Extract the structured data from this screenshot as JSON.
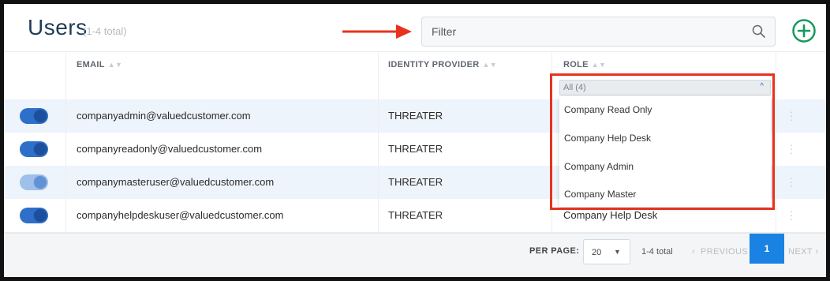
{
  "header": {
    "title": "Users",
    "count": "(1-4 total)",
    "filter_placeholder": "Filter"
  },
  "table": {
    "columns": {
      "email": "EMAIL",
      "identity_provider": "IDENTITY PROVIDER",
      "role": "ROLE"
    },
    "rows": [
      {
        "enabled": true,
        "email": "companyadmin@valuedcustomer.com",
        "identity_provider": "THREATER",
        "role": ""
      },
      {
        "enabled": true,
        "email": "companyreadonly@valuedcustomer.com",
        "identity_provider": "THREATER",
        "role": ""
      },
      {
        "enabled": true,
        "email": "companymasteruser@valuedcustomer.com",
        "identity_provider": "THREATER",
        "role": ""
      },
      {
        "enabled": true,
        "email": "companyhelpdeskuser@valuedcustomer.com",
        "identity_provider": "THREATER",
        "role": "Company Help Desk"
      }
    ]
  },
  "role_filter": {
    "selected": "All (4)",
    "options": [
      "Company Read Only",
      "Company Help Desk",
      "Company Admin",
      "Company Master"
    ]
  },
  "pagination": {
    "per_page_label": "PER PAGE:",
    "per_page_value": "20",
    "total": "1-4 total",
    "previous": "PREVIOUS",
    "current_page": "1",
    "next": "NEXT"
  },
  "colors": {
    "accent": "#1a82e2",
    "toggle_on": "#2e6fc9",
    "row_alt": "#eef4fb",
    "highlight": "#e8321e",
    "add_button": "#17995a"
  }
}
